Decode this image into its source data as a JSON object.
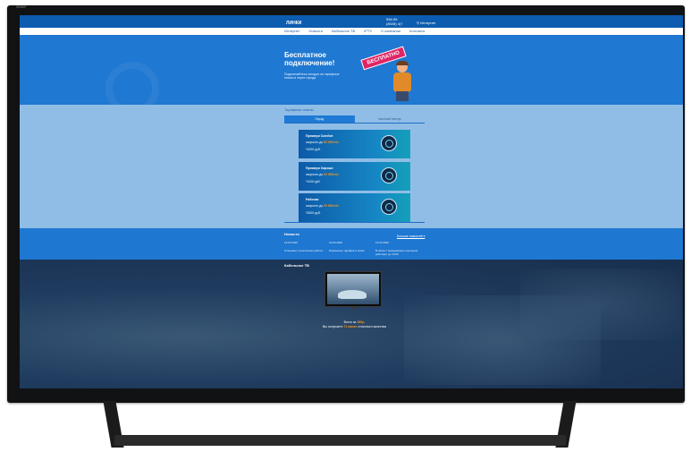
{
  "tv_brand": "SONY",
  "header": {
    "logo": "ЛИНКИ",
    "phone_line1": "556-55",
    "phone_line2": "(8928) 4(7",
    "internet_link": "Интернет"
  },
  "nav": [
    "Интернет",
    "Новости",
    "Кабельное ТВ",
    "IPTV",
    "О компании",
    "Контакты"
  ],
  "hero": {
    "title": "Бесплатное подключение!",
    "subtitle": "Подключайтесь сегодня на тарифные планы в черте города",
    "badge": "БЕСПЛАТНО"
  },
  "tariffs": {
    "heading": "Тарифные планы",
    "tabs": [
      "Город",
      "Частный сектор"
    ],
    "cards": [
      {
        "name": "Премиум Comfort",
        "speed_prefix": "скорость до",
        "speed": "50 Мбит/с",
        "price": "*4200 руб."
      },
      {
        "name": "Премиум Хорошо",
        "speed_prefix": "скорость до",
        "speed": "20 Мбит/с",
        "price": "*1100 руб."
      },
      {
        "name": "Рабочая",
        "speed_prefix": "скорость до",
        "speed": "20 Мбит/с",
        "price": "*2000 руб."
      }
    ]
  },
  "news": {
    "title": "Новости",
    "all_link": "Больше новостей ▾",
    "items": [
      {
        "date": "19.03.2020",
        "text": "Плановые технические работы"
      },
      {
        "date": "19.03.2020",
        "text": "Изменение тарифов в связи"
      },
      {
        "date": "13.03.2020",
        "text": "В связи с праздниками отделения работают до 13:00"
      }
    ]
  },
  "cable_tv": {
    "title": "Кабельное ТВ",
    "price_line_prefix": "Всего за",
    "price": "180р.",
    "channels_prefix": "Вы получаете",
    "channels": "71 канал",
    "channels_suffix": "отличного качества"
  }
}
